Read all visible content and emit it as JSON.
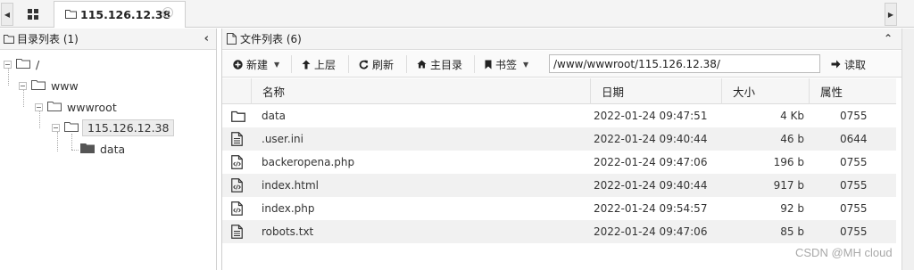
{
  "tab_bar": {
    "scroll_left_icon": "caret-left-icon",
    "scroll_right_icon": "caret-right-icon",
    "grid_icon": "grid-icon",
    "active_tab": {
      "label": "115.126.12.38",
      "icon": "folder-icon",
      "close_icon": "close-icon"
    }
  },
  "left_panel": {
    "title": "目录列表 (1)",
    "tree": [
      {
        "label": "/",
        "level": 0,
        "icon": "folder-open-icon"
      },
      {
        "label": "www",
        "level": 1,
        "icon": "folder-open-icon"
      },
      {
        "label": "wwwroot",
        "level": 2,
        "icon": "folder-open-icon"
      },
      {
        "label": "115.126.12.38",
        "level": 3,
        "icon": "folder-open-icon",
        "selected": true
      },
      {
        "label": "data",
        "level": 4,
        "icon": "folder-filled-icon"
      }
    ]
  },
  "right_panel": {
    "title": "文件列表 (6)",
    "toolbar": {
      "new_label": "新建",
      "up_label": "上层",
      "refresh_label": "刷新",
      "home_label": "主目录",
      "bookmark_label": "书签",
      "path_value": "/www/wwwroot/115.126.12.38/",
      "read_label": "读取"
    },
    "columns": {
      "name": "名称",
      "date": "日期",
      "size": "大小",
      "attr": "属性"
    },
    "files": [
      {
        "icon": "folder-icon",
        "name": "data",
        "date": "2022-01-24 09:47:51",
        "size": "4 Kb",
        "attr": "0755"
      },
      {
        "icon": "text-file-icon",
        "name": ".user.ini",
        "date": "2022-01-24 09:40:44",
        "size": "46 b",
        "attr": "0644"
      },
      {
        "icon": "code-file-icon",
        "name": "backeropena.php",
        "date": "2022-01-24 09:47:06",
        "size": "196 b",
        "attr": "0755"
      },
      {
        "icon": "code-file-icon",
        "name": "index.html",
        "date": "2022-01-24 09:40:44",
        "size": "917 b",
        "attr": "0755"
      },
      {
        "icon": "code-file-icon",
        "name": "index.php",
        "date": "2022-01-24 09:54:57",
        "size": "92 b",
        "attr": "0755"
      },
      {
        "icon": "text-file-icon",
        "name": "robots.txt",
        "date": "2022-01-24 09:47:06",
        "size": "85 b",
        "attr": "0755"
      }
    ]
  },
  "watermark": "CSDN @MH cloud"
}
